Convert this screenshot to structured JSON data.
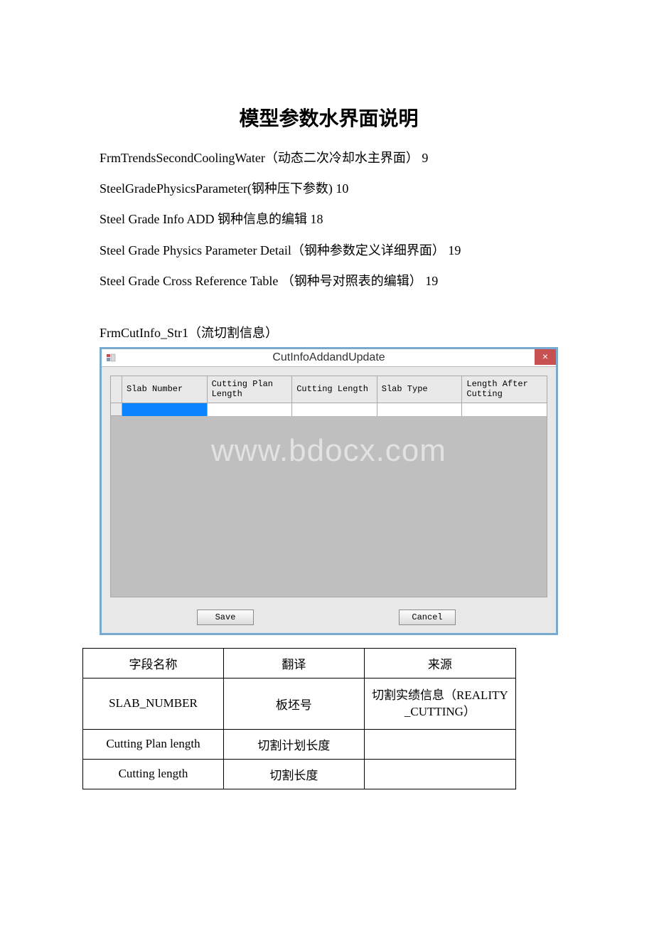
{
  "doc": {
    "title": "模型参数水界面说明",
    "toc": [
      "FrmTrendsSecondCoolingWater（动态二次冷却水主界面） 9",
      "SteelGradePhysicsParameter(钢种压下参数) 10",
      "Steel Grade Info ADD 钢种信息的编辑 18",
      "Steel Grade Physics Parameter Detail（钢种参数定义详细界面） 19",
      "Steel Grade Cross Reference Table （钢种号对照表的编辑） 19"
    ],
    "section_label": "FrmCutInfo_Str1（流切割信息）"
  },
  "window": {
    "title": "CutInfoAddandUpdate",
    "close_label": "×",
    "columns": [
      "Slab Number",
      "Cutting Plan Length",
      "Cutting Length",
      "Slab Type",
      "Length After Cutting"
    ],
    "save_label": "Save",
    "cancel_label": "Cancel",
    "watermark": "www.bdocx.com"
  },
  "table": {
    "headers": [
      "字段名称",
      "翻译",
      "来源"
    ],
    "rows": [
      {
        "field": "SLAB_NUMBER",
        "trans": "板坯号",
        "source": "切割实绩信息（REALITY _CUTTING）"
      },
      {
        "field": "Cutting Plan length",
        "trans": "切割计划长度",
        "source": ""
      },
      {
        "field": "Cutting length",
        "trans": "切割长度",
        "source": ""
      }
    ]
  }
}
